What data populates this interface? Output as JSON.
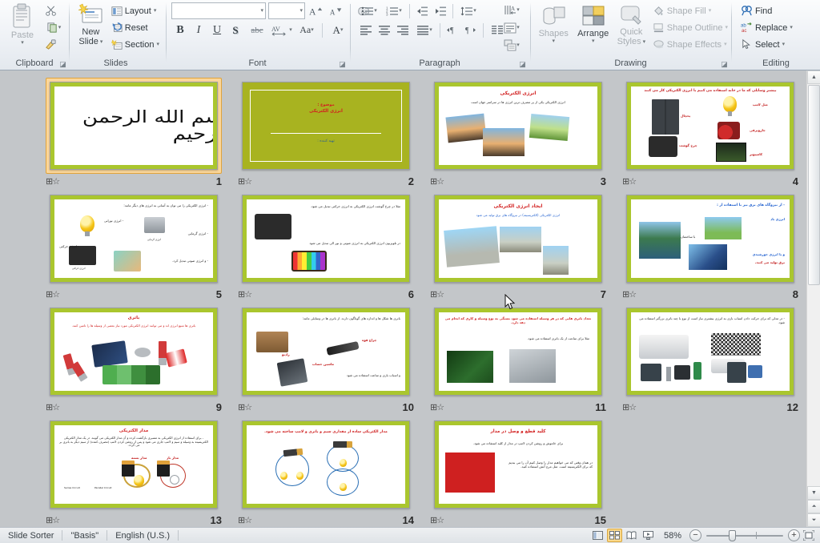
{
  "ribbon": {
    "groups": [
      {
        "name": "clipboard",
        "label": "Clipboard"
      },
      {
        "name": "slides",
        "label": "Slides"
      },
      {
        "name": "font",
        "label": "Font"
      },
      {
        "name": "paragraph",
        "label": "Paragraph"
      },
      {
        "name": "drawing",
        "label": "Drawing"
      },
      {
        "name": "editing",
        "label": "Editing"
      }
    ],
    "clipboard": {
      "paste": "Paste",
      "cut_icon": "scissors-icon",
      "copy_icon": "copy-icon",
      "format_painter_icon": "format-painter-icon",
      "dialog_launcher": "◪"
    },
    "slides": {
      "new_slide_line1": "New",
      "new_slide_line2": "Slide",
      "layout": "Layout",
      "reset": "Reset",
      "section": "Section"
    },
    "font": {
      "font_name_value": "",
      "font_size_value": "",
      "grow_font_icon": "grow-font-icon",
      "shrink_font_icon": "shrink-font-icon",
      "clear_formatting_icon": "clear-formatting-icon",
      "bold": "B",
      "italic": "I",
      "underline": "U",
      "shadow": "S",
      "strikethrough": "abc",
      "character_spacing": "AV",
      "change_case": "Aa",
      "font_color": "A"
    },
    "paragraph": {
      "bullets_icon": "bullets-icon",
      "numbering_icon": "numbering-icon",
      "decrease_indent_icon": "decrease-indent-icon",
      "increase_indent_icon": "increase-indent-icon",
      "line_spacing_icon": "line-spacing-icon",
      "align_left_icon": "align-left-icon",
      "align_center_icon": "align-center-icon",
      "align_right_icon": "align-right-icon",
      "justify_icon": "justify-icon",
      "ltr_icon": "text-direction-ltr-icon",
      "rtl_icon": "text-direction-rtl-icon",
      "columns_icon": "columns-icon",
      "text_direction_icon": "text-direction-icon",
      "align_text_icon": "align-text-icon",
      "convert_smartart_icon": "convert-to-smartart-icon"
    },
    "drawing": {
      "shapes": "Shapes",
      "arrange": "Arrange",
      "quick_styles_line1": "Quick",
      "quick_styles_line2": "Styles",
      "shape_fill": "Shape Fill",
      "shape_outline": "Shape Outline",
      "shape_effects": "Shape Effects"
    },
    "editing": {
      "find": "Find",
      "replace": "Replace",
      "select": "Select"
    }
  },
  "sorter": {
    "selected_slide": 1,
    "slides": [
      {
        "number": "4",
        "kind": "white",
        "title": "",
        "heading": "بیشتر وسایلی که ما در خانه استفاده می کنیم با انرژی الکتریکی کار می کنند",
        "labels": [
          "مثل لامپ",
          "یخچال",
          "جاروبرقی",
          "چرخ گوشت",
          "کامپیوتر"
        ],
        "animated": true
      },
      {
        "number": "3",
        "kind": "white",
        "title": "انرژی الکتریکی",
        "heading": "انرژی الکتریکی یکی از پر مصرف ترین انرژی ها در سراسر جهان است",
        "labels": [],
        "animated": true
      },
      {
        "number": "2",
        "kind": "olive",
        "title": "موضوع :",
        "subtitle": "انرژی الکتریکی",
        "footer": "تهیه کننده :",
        "labels": [],
        "animated": true
      },
      {
        "number": "1",
        "kind": "bismillah",
        "title": "بسم الله الرحمن الرحیم",
        "labels": [],
        "animated": true
      },
      {
        "number": "8",
        "kind": "white",
        "title": "",
        "heading": "- از نیروگاه های برق نیز با استفاده از :",
        "labels": [
          "انرژی باد",
          "با ساختمان",
          "و یا انرژی خورشیدی",
          "برق تولید می کنند."
        ],
        "animated": true
      },
      {
        "number": "7",
        "kind": "white",
        "title": "ایجاد انرژی الکتریکی",
        "heading": "انرژی الکتریکی (الکتریسیته) در نیروگاه های برق تولید می شود",
        "labels": [],
        "animated": true
      },
      {
        "number": "6",
        "kind": "white",
        "title": "",
        "heading": "مثلا در چرخ گوشت انرژی الکتریکی به انرژی حرکتی تبدیل می شود.",
        "heading2": "در تلویزیون انرژی الکتریکی به انرژی صوتی و نور الی تبدیل می شود",
        "labels": [],
        "animated": true
      },
      {
        "number": "5",
        "kind": "white",
        "title": "",
        "heading": "- انرژی الکتریکی را می توان به آسانی به انرژی های دیگر مانند:",
        "labels": [
          "- انرژی نورانی",
          "- انرژی گرمایی",
          "- انرژی حرکتی",
          "- و انرژی صوتی تبدیل کرد.",
          "انرژی گرمایی",
          "انرژی حرکتی"
        ],
        "animated": true
      },
      {
        "number": "12",
        "kind": "white",
        "title": "",
        "heading": "- در مدلی که برای حرکت دادن اسباب بازی به انرژی بیشتری نیاز است از نوع با چند باتری بزرگتر استفاده می شود.",
        "labels": [],
        "animated": true
      },
      {
        "number": "11",
        "kind": "white",
        "title": "",
        "heading": "تعداد باتری  هایی که در هر وسیله استفاده می شود بستگی به نوع وسیله و کاری که انجام می دهد دارد.",
        "heading2": "مثلا برای ساعت از یک باتری  استفاده می شود.",
        "labels": [],
        "animated": true
      },
      {
        "number": "10",
        "kind": "white",
        "title": "",
        "heading": "باتری ها شکل ها و اندازه های گوناگون دارند. از باتری ها در وسایلی مانند:",
        "labels": [
          "چراغ قوه",
          "رادیو",
          "ماشین حساب",
          "و اسباب بازی و ساعت استفاده می شود"
        ],
        "animated": true
      },
      {
        "number": "9",
        "kind": "white",
        "title": "باتری",
        "heading": "باتری ها منبع انرژی اند و می توانند انرژی  الکتریکی مورد نیاز بعضی از وسیله ها را تامین کنند.",
        "labels": [],
        "animated": true
      },
      {
        "number": "15",
        "kind": "white",
        "title": "کلید قطع و وصل در مدار",
        "heading": "برای خاموش و روشن کردن لامپ در مدار از کلید استفاده می شود.",
        "heading2": "در همان وقتی که می خواهیم مدار را وصل کنیم آن را می بندیم که برای الکتریسیته است. مثل مرج آتش استفاده کنید.",
        "labels": [],
        "animated": true
      },
      {
        "number": "14",
        "kind": "white",
        "title": "",
        "heading": "مدار الکتریکی ساده از مقداری سیم و باتری و لامپ ساخته می شود.",
        "labels": [],
        "animated": true
      },
      {
        "number": "13",
        "kind": "white",
        "title": "مدار الکتریکی",
        "heading": "- برای استفاده از انرژی الکتریکی به مسیری بازگشت کرده و آن مدار الکتریکی می گویند. در یک مدار الکتریکی الکتریسیته به وسیله و سیم و لامپ جاری می شود و پس از روشن کردن لامپ (مصرف کننده) از سیم دیگر به باتری بر می گردد.",
        "labels": [
          "مدار بسته",
          "مدار باز"
        ],
        "animated": true
      }
    ]
  },
  "status": {
    "view_name": "Slide Sorter",
    "theme_name": "\"Basis\"",
    "language": "English (U.S.)",
    "zoom_level": "58%",
    "views": [
      {
        "name": "normal-view-button",
        "label": "Normal",
        "active": false
      },
      {
        "name": "slide-sorter-view-button",
        "label": "Slide Sorter",
        "active": true
      },
      {
        "name": "reading-view-button",
        "label": "Reading View",
        "active": false
      },
      {
        "name": "slide-show-button",
        "label": "Slide Show",
        "active": false
      }
    ],
    "zoom_out": "−",
    "zoom_in": "+",
    "fit_to_window": "fit-slide-to-window-icon"
  },
  "colors": {
    "slide_border_green": "#aac62e",
    "slide_olive_bg": "#a8b320",
    "selection_gold": "#fbd79b",
    "title_red": "#d21f1f",
    "workspace_gray": "#c3c6c9"
  }
}
